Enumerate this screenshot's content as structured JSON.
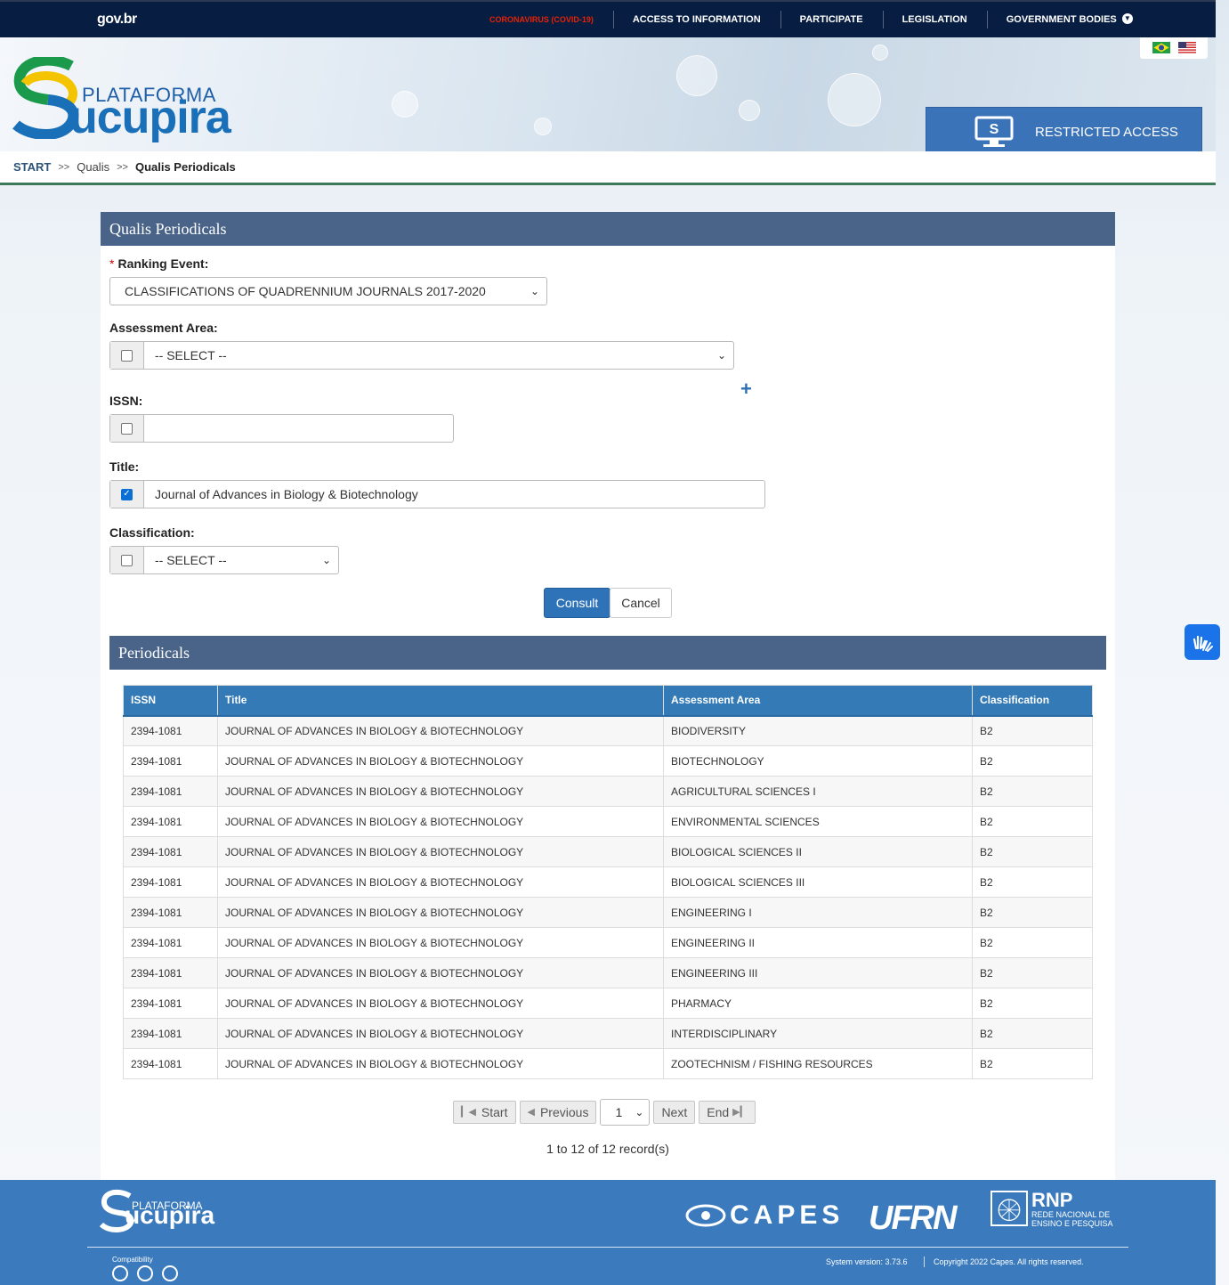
{
  "govbar": {
    "logo": "gov.br",
    "nav": [
      {
        "label": "CORONAVIRUS (COVID-19)",
        "type": "covid"
      },
      {
        "label": "ACCESS TO INFORMATION"
      },
      {
        "label": "PARTICIPATE"
      },
      {
        "label": "LEGISLATION"
      },
      {
        "label": "GOVERNMENT BODIES",
        "has_dropdown": true
      }
    ]
  },
  "header": {
    "logo_small": "PLATAFORMA",
    "logo_big": "ucupira",
    "restricted_access": "RESTRICTED ACCESS",
    "colors": {
      "brand_blue": "#1a70b8",
      "brand_yellow": "#f4c400",
      "brand_green": "#1b9a4b"
    }
  },
  "breadcrumb": {
    "start": "START",
    "sep": ">>",
    "middle": "Qualis",
    "current": "Qualis Periodicals"
  },
  "form": {
    "title": "Qualis Periodicals",
    "ranking_label": "Ranking Event:",
    "ranking_required_mark": "*",
    "ranking_value": "CLASSIFICATIONS OF QUADRENNIUM JOURNALS 2017-2020",
    "area_label": "Assessment Area:",
    "area_value": "-- SELECT --",
    "area_checked": false,
    "plus": "+",
    "issn_label": "ISSN:",
    "issn_value": "",
    "issn_checked": false,
    "title_label": "Title:",
    "title_value": "Journal of Advances in Biology & Biotechnology",
    "title_checked": true,
    "class_label": "Classification:",
    "class_value": "-- SELECT --",
    "class_checked": false,
    "consult": "Consult",
    "cancel": "Cancel"
  },
  "results": {
    "title": "Periodicals",
    "columns": [
      "ISSN",
      "Title",
      "Assessment Area",
      "Classification"
    ],
    "rows": [
      [
        "2394-1081",
        "JOURNAL OF ADVANCES IN BIOLOGY & BIOTECHNOLOGY",
        "BIODIVERSITY",
        "B2"
      ],
      [
        "2394-1081",
        "JOURNAL OF ADVANCES IN BIOLOGY & BIOTECHNOLOGY",
        "BIOTECHNOLOGY",
        "B2"
      ],
      [
        "2394-1081",
        "JOURNAL OF ADVANCES IN BIOLOGY & BIOTECHNOLOGY",
        "AGRICULTURAL SCIENCES I",
        "B2"
      ],
      [
        "2394-1081",
        "JOURNAL OF ADVANCES IN BIOLOGY & BIOTECHNOLOGY",
        "ENVIRONMENTAL SCIENCES",
        "B2"
      ],
      [
        "2394-1081",
        "JOURNAL OF ADVANCES IN BIOLOGY & BIOTECHNOLOGY",
        "BIOLOGICAL SCIENCES II",
        "B2"
      ],
      [
        "2394-1081",
        "JOURNAL OF ADVANCES IN BIOLOGY & BIOTECHNOLOGY",
        "BIOLOGICAL SCIENCES III",
        "B2"
      ],
      [
        "2394-1081",
        "JOURNAL OF ADVANCES IN BIOLOGY & BIOTECHNOLOGY",
        "ENGINEERING I",
        "B2"
      ],
      [
        "2394-1081",
        "JOURNAL OF ADVANCES IN BIOLOGY & BIOTECHNOLOGY",
        "ENGINEERING II",
        "B2"
      ],
      [
        "2394-1081",
        "JOURNAL OF ADVANCES IN BIOLOGY & BIOTECHNOLOGY",
        "ENGINEERING III",
        "B2"
      ],
      [
        "2394-1081",
        "JOURNAL OF ADVANCES IN BIOLOGY & BIOTECHNOLOGY",
        "PHARMACY",
        "B2"
      ],
      [
        "2394-1081",
        "JOURNAL OF ADVANCES IN BIOLOGY & BIOTECHNOLOGY",
        "INTERDISCIPLINARY",
        "B2"
      ],
      [
        "2394-1081",
        "JOURNAL OF ADVANCES IN BIOLOGY & BIOTECHNOLOGY",
        "ZOOTECHNISM / FISHING RESOURCES",
        "B2"
      ]
    ],
    "pager": {
      "start": "Start",
      "previous": "Previous",
      "page": "1",
      "next": "Next",
      "end": "End"
    },
    "record_info": "1 to 12 of 12 record(s)"
  },
  "footer": {
    "logo_small": "PLATAFORMA",
    "logo_big": "ucupira",
    "capes": "CAPES",
    "ufrn": "UFRN",
    "rnp": "RNP",
    "rnp_sub1": "REDE NACIONAL DE",
    "rnp_sub2": "ENSINO E PESQUISA",
    "compatibility": "Compatibility",
    "version": "System version: 3.73.6",
    "copyright": "Copyright 2022 Capes. All rights reserved."
  }
}
